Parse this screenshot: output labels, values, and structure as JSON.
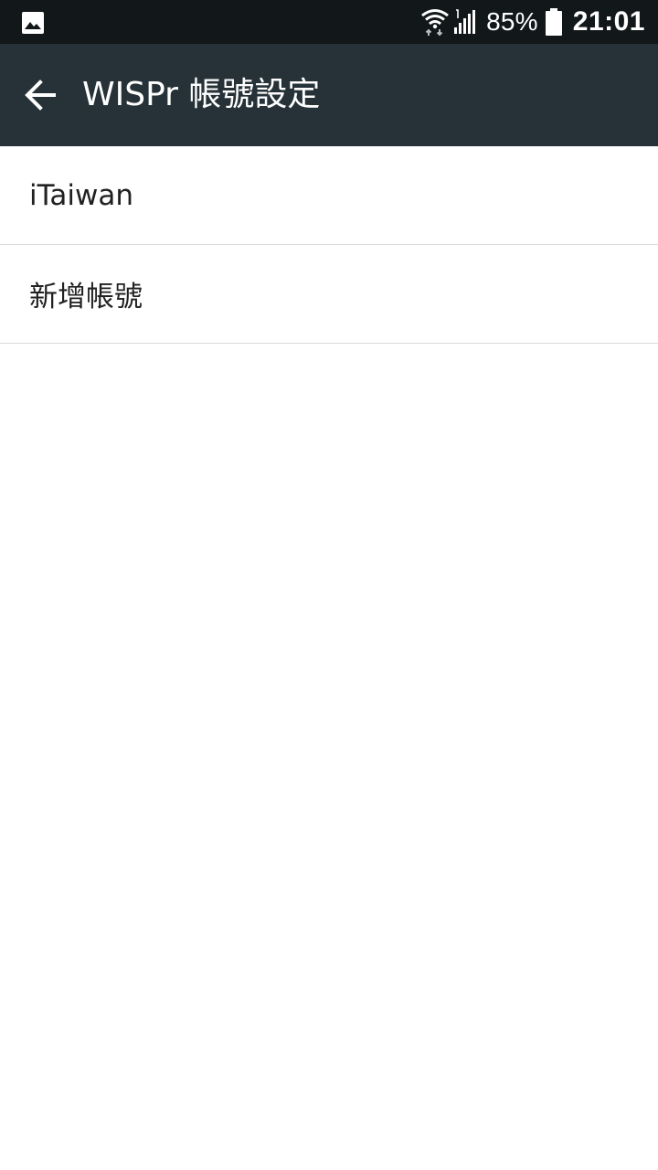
{
  "status_bar": {
    "left_icon": "image-notification-icon",
    "battery_percent": "85%",
    "time": "21:01"
  },
  "app_bar": {
    "back_icon": "back-arrow-icon",
    "title": "WISPr 帳號設定"
  },
  "accounts": {
    "items": [
      {
        "label": "iTaiwan"
      },
      {
        "label": "新增帳號"
      }
    ]
  },
  "colors": {
    "status_bar_bg": "#12171a",
    "app_bar_bg": "#263238",
    "list_text": "#212121",
    "divider": "#dcdcdc"
  }
}
